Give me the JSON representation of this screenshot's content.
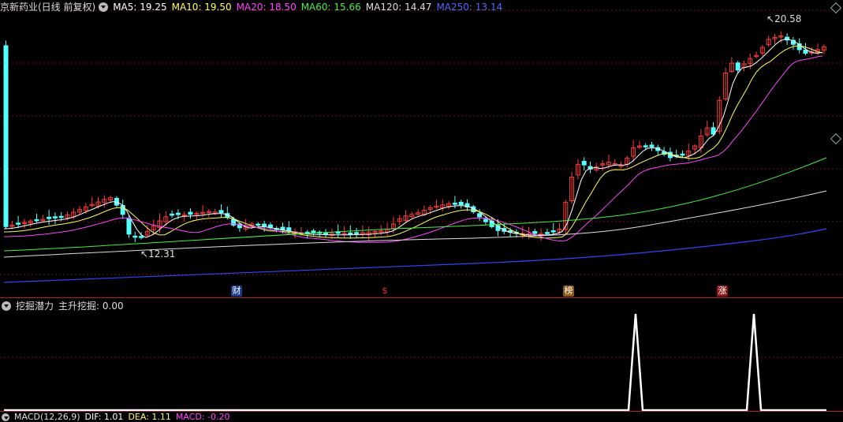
{
  "main": {
    "title": "京新药业(日线 前复权)",
    "indicators": [
      {
        "label": "MA5: 19.25",
        "color": "#ffffff"
      },
      {
        "label": "MA10: 19.50",
        "color": "#ffff55"
      },
      {
        "label": "MA20: 18.50",
        "color": "#ff44ff"
      },
      {
        "label": "MA60: 15.66",
        "color": "#44ee44"
      },
      {
        "label": "MA120: 14.47",
        "color": "#dddddd"
      },
      {
        "label": "MA250: 13.14",
        "color": "#5566ff"
      }
    ],
    "high_label": "20.58",
    "low_label": "12.31",
    "markers": [
      {
        "text": "财",
        "color": "#ffffff",
        "bg": "#1a3a8a"
      },
      {
        "text": "$",
        "color": "#ff3333",
        "bg": "#000000"
      },
      {
        "text": "榜",
        "color": "#ffffff",
        "bg": "#8a5a1a"
      },
      {
        "text": "涨",
        "color": "#ffffff",
        "bg": "#8a1a1a"
      }
    ]
  },
  "sub": {
    "title": "挖掘潜力",
    "indicator": "主升挖掘: 0.00"
  },
  "macd": {
    "title": "MACD(12,26,9)",
    "dif": "DIF: 1.01",
    "dea": "DEA: 1.11",
    "macd": "MACD: -0.20"
  },
  "colors": {
    "up": "#ff3b3b",
    "down": "#54ffff",
    "grid": "#7a1010"
  }
}
